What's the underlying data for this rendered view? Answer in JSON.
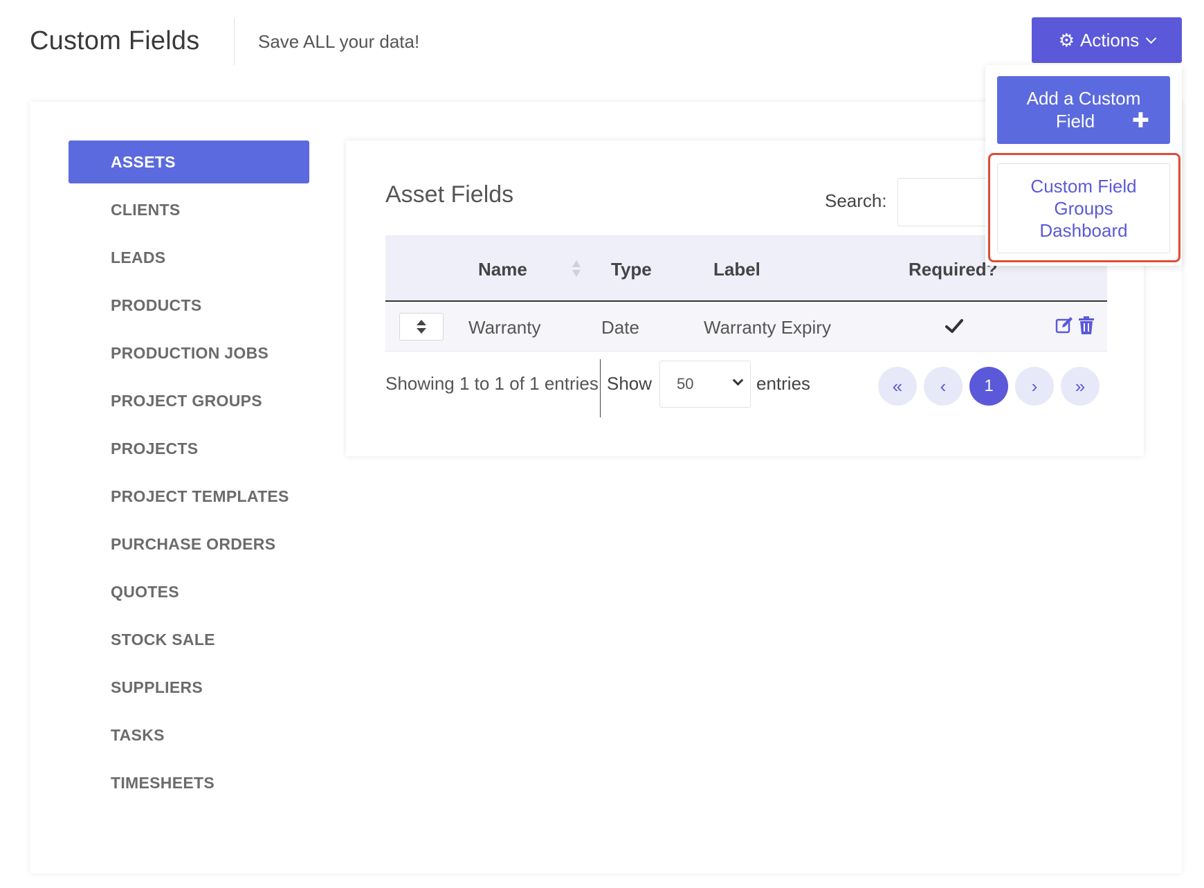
{
  "header": {
    "title": "Custom Fields",
    "subtitle": "Save ALL your data!",
    "actions_label": "Actions"
  },
  "dropdown": {
    "add_field_line1": "Add a Custom",
    "add_field_line2": "Field",
    "dashboard_line1": "Custom Field",
    "dashboard_line2": "Groups",
    "dashboard_line3": "Dashboard"
  },
  "sidebar": {
    "items": [
      {
        "label": "ASSETS",
        "active": true
      },
      {
        "label": "CLIENTS"
      },
      {
        "label": "LEADS"
      },
      {
        "label": "PRODUCTS"
      },
      {
        "label": "PRODUCTION JOBS"
      },
      {
        "label": "PROJECT GROUPS"
      },
      {
        "label": "PROJECTS"
      },
      {
        "label": "PROJECT TEMPLATES"
      },
      {
        "label": "PURCHASE ORDERS"
      },
      {
        "label": "QUOTES"
      },
      {
        "label": "STOCK SALE"
      },
      {
        "label": "SUPPLIERS"
      },
      {
        "label": "TASKS"
      },
      {
        "label": "TIMESHEETS"
      }
    ]
  },
  "section": {
    "title": "Asset Fields",
    "search_label": "Search:",
    "search_value": ""
  },
  "table": {
    "columns": [
      "Name",
      "Type",
      "Label",
      "Required?"
    ],
    "rows": [
      {
        "name": "Warranty",
        "type": "Date",
        "label": "Warranty Expiry",
        "required": true
      }
    ]
  },
  "footer": {
    "showing": "Showing 1 to 1 of 1 entries",
    "show_label": "Show",
    "page_length": "50",
    "entries_label": "entries",
    "current_page": "1",
    "first": "«",
    "prev": "‹",
    "next": "›",
    "last": "»"
  },
  "colors": {
    "accent": "#5b59d9",
    "sidebar_active": "#5b6ade",
    "highlight": "#e04b35"
  }
}
